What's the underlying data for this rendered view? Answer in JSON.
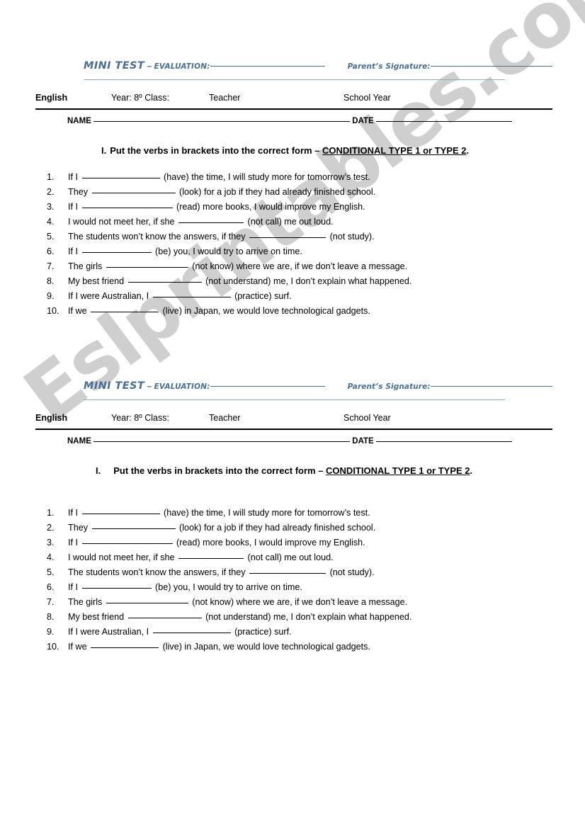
{
  "watermark": {
    "text": "Eslprintables.com",
    "color": "#cfcfcf"
  },
  "accent_color": "#4a6f96",
  "header": {
    "mini_test": "MINI TEST",
    "dash": " – ",
    "evaluation_label": "EVALUATION:",
    "parent_signature_label": "Parent’s Signature:"
  },
  "meta": {
    "subject": "English",
    "year_label": "Year:",
    "year_value": "8º",
    "class_label": "Class:",
    "teacher": "Teacher",
    "school_year": "School Year"
  },
  "namedate": {
    "name_label": "NAME",
    "date_label": "DATE"
  },
  "instruction": {
    "number": "I.",
    "text_before": "Put the verbs in brackets into the correct form – ",
    "underlined": "CONDITIONAL TYPE 1 or TYPE 2",
    "period": "."
  },
  "exercises": [
    {
      "n": "1.",
      "pre": "If I ",
      "gap": 110,
      "post": " (have) the time, I will study more for tomorrow’s test."
    },
    {
      "n": "2.",
      "pre": "They ",
      "gap": 118,
      "post": " (look) for a job if they had already finished school."
    },
    {
      "n": "3.",
      "pre": "If I ",
      "gap": 128,
      "post": " (read) more books, I would improve my English."
    },
    {
      "n": "4.",
      "pre": "I would not meet her, if she ",
      "gap": 92,
      "post": " (not call) me out loud."
    },
    {
      "n": "5.",
      "pre": "The students won’t know the answers, if they ",
      "gap": 108,
      "post": " (not study)."
    },
    {
      "n": "6.",
      "pre": "If I ",
      "gap": 98,
      "post": " (be) you, I would try to arrive on time."
    },
    {
      "n": "7.",
      "pre": "The girls ",
      "gap": 116,
      "post": " (not know) where we are, if we don’t leave a message."
    },
    {
      "n": "8.",
      "pre": "My best friend ",
      "gap": 104,
      "post": " (not understand) me, I  don’t explain what happened."
    },
    {
      "n": "9.",
      "pre": "If I were Australian, I ",
      "gap": 110,
      "post": " (practice) surf."
    },
    {
      "n": "10.",
      "pre": "If we ",
      "gap": 96,
      "post": " (live) in Japan, we would love technological gadgets."
    }
  ]
}
